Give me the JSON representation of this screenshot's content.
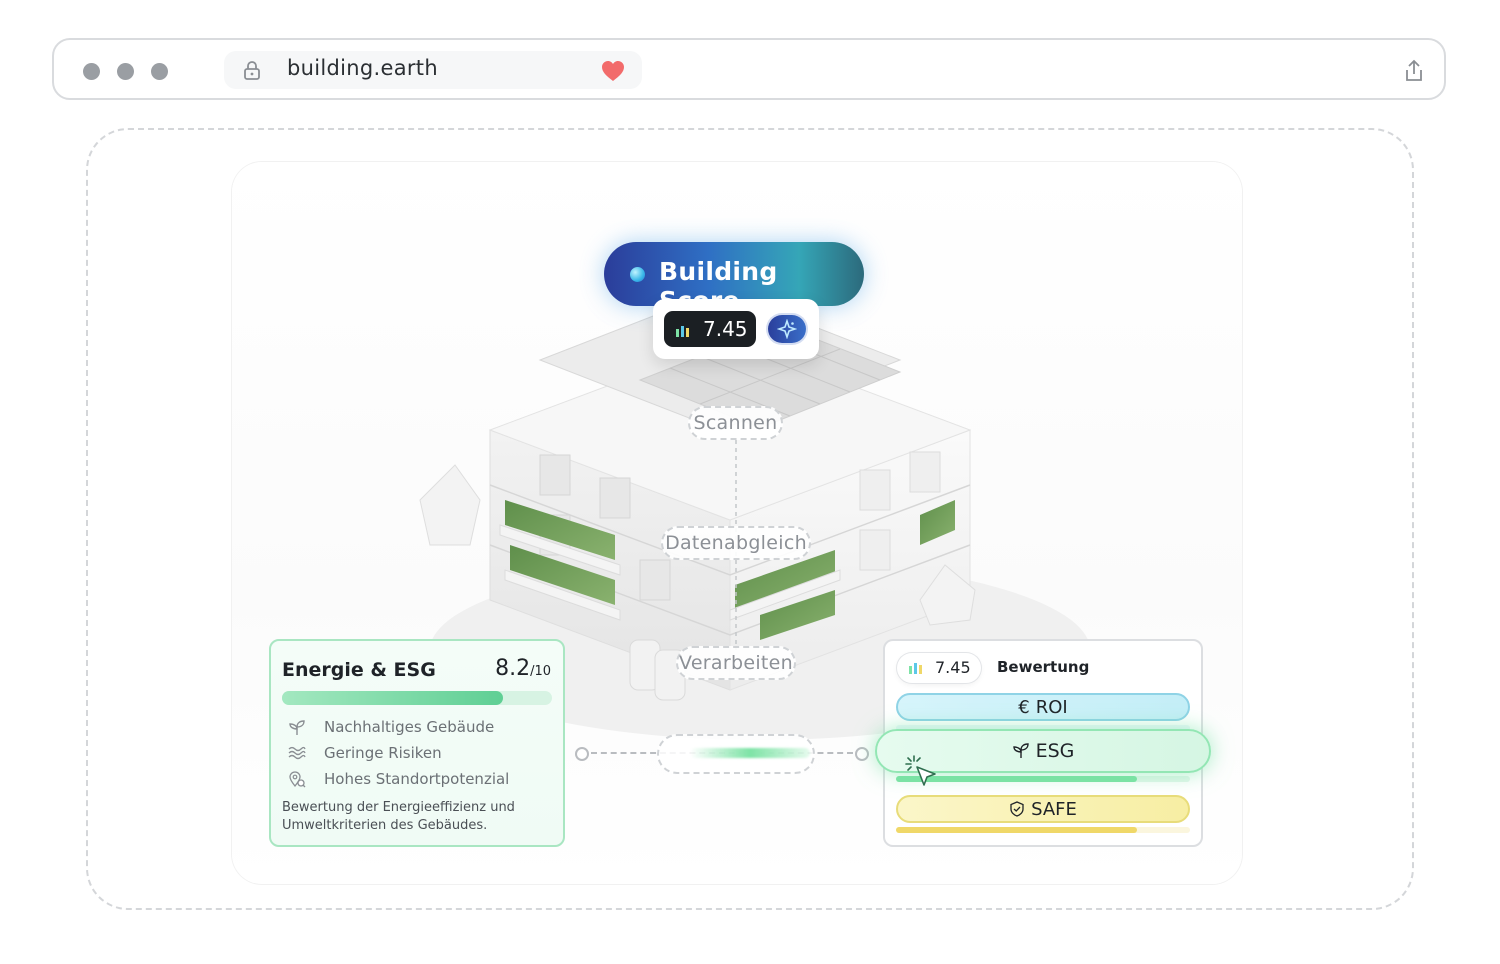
{
  "browser": {
    "url": "building.earth"
  },
  "score": {
    "title": "Building Score",
    "value": "7.45"
  },
  "steps": {
    "scan": "Scannen",
    "match": "Datenabgleich",
    "process": "Verarbeiten"
  },
  "energy_card": {
    "title": "Energie & ESG",
    "score": "8.2",
    "score_max": "/10",
    "progress_fraction": 0.82,
    "items": [
      {
        "icon": "sprout-icon",
        "label": "Nachhaltiges Gebäude"
      },
      {
        "icon": "waves-icon",
        "label": "Geringe Risiken"
      },
      {
        "icon": "location-search-icon",
        "label": "Hohes Standortpotenzial"
      }
    ],
    "description": "Bewertung der Energieeffizienz und Umweltkriterien des Gebäudes."
  },
  "rating_card": {
    "score": "7.45",
    "label": "Bewertung",
    "buttons": {
      "roi": "ROI",
      "esg": "ESG",
      "safe": "SAFE"
    },
    "esg_progress_fraction": 0.82,
    "safe_progress_fraction": 0.82
  },
  "colors": {
    "score_gradient_start": "#2b3d9a",
    "score_gradient_end": "#35a6b7",
    "energy_accent": "#5fcf94",
    "roi_accent": "#8fd3e6",
    "esg_accent": "#7ee3a6",
    "safe_accent": "#f0d868",
    "favorite_heart": "#f26b6b"
  }
}
